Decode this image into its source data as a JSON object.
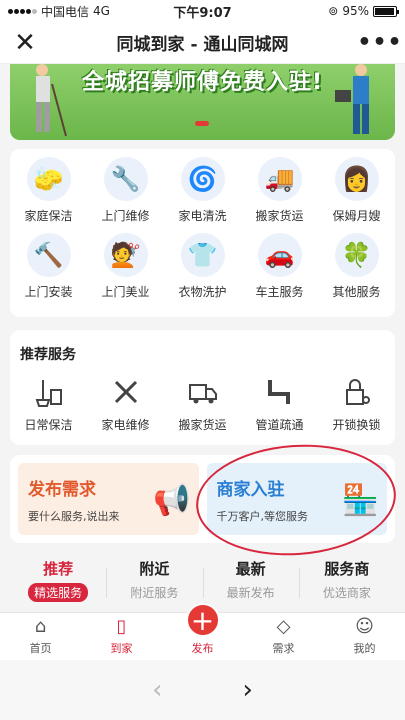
{
  "status": {
    "carrier": "中国电信",
    "network": "4G",
    "time": "下午9:07",
    "battery": "95%",
    "battery_level": 0.95
  },
  "nav": {
    "title": "同城到家 - 通山同城网",
    "close_icon": "close-icon",
    "more_icon": "more-icon"
  },
  "banner": {
    "text": "全城招募师傅免费入驻!"
  },
  "services": [
    {
      "label": "家庭保洁",
      "icon": "cleaning-icon"
    },
    {
      "label": "上门维修",
      "icon": "wrench-icon"
    },
    {
      "label": "家电清洗",
      "icon": "washer-icon"
    },
    {
      "label": "搬家货运",
      "icon": "truck-icon"
    },
    {
      "label": "保姆月嫂",
      "icon": "nanny-icon"
    },
    {
      "label": "上门安装",
      "icon": "hammer-icon"
    },
    {
      "label": "上门美业",
      "icon": "beauty-icon"
    },
    {
      "label": "衣物洗护",
      "icon": "shirt-icon"
    },
    {
      "label": "车主服务",
      "icon": "car-icon"
    },
    {
      "label": "其他服务",
      "icon": "clover-icon"
    }
  ],
  "recommend": {
    "title": "推荐服务",
    "items": [
      {
        "label": "日常保洁",
        "icon": "mop-icon"
      },
      {
        "label": "家电维修",
        "icon": "tools-icon"
      },
      {
        "label": "搬家货运",
        "icon": "truck-icon"
      },
      {
        "label": "管道疏通",
        "icon": "pipe-icon"
      },
      {
        "label": "开锁换锁",
        "icon": "lock-icon"
      }
    ]
  },
  "promo": {
    "post": {
      "title": "发布需求",
      "subtitle": "要什么服务,说出来"
    },
    "merchant": {
      "title": "商家入驻",
      "subtitle": "千万客户,等您服务"
    }
  },
  "tabs": [
    {
      "name": "推荐",
      "sub": "精选服务"
    },
    {
      "name": "附近",
      "sub": "附近服务"
    },
    {
      "name": "最新",
      "sub": "最新发布"
    },
    {
      "name": "服务商",
      "sub": "优选商家"
    }
  ],
  "bottom": [
    {
      "label": "首页",
      "icon": "home-icon"
    },
    {
      "label": "到家",
      "icon": "door-icon"
    },
    {
      "label": "发布",
      "icon": "plus-icon"
    },
    {
      "label": "需求",
      "icon": "tag-icon"
    },
    {
      "label": "我的",
      "icon": "user-icon"
    }
  ],
  "browser": {
    "back": "‹",
    "forward": "›"
  },
  "colors": {
    "accent": "#d7263d",
    "banner": "#6bb64a"
  }
}
